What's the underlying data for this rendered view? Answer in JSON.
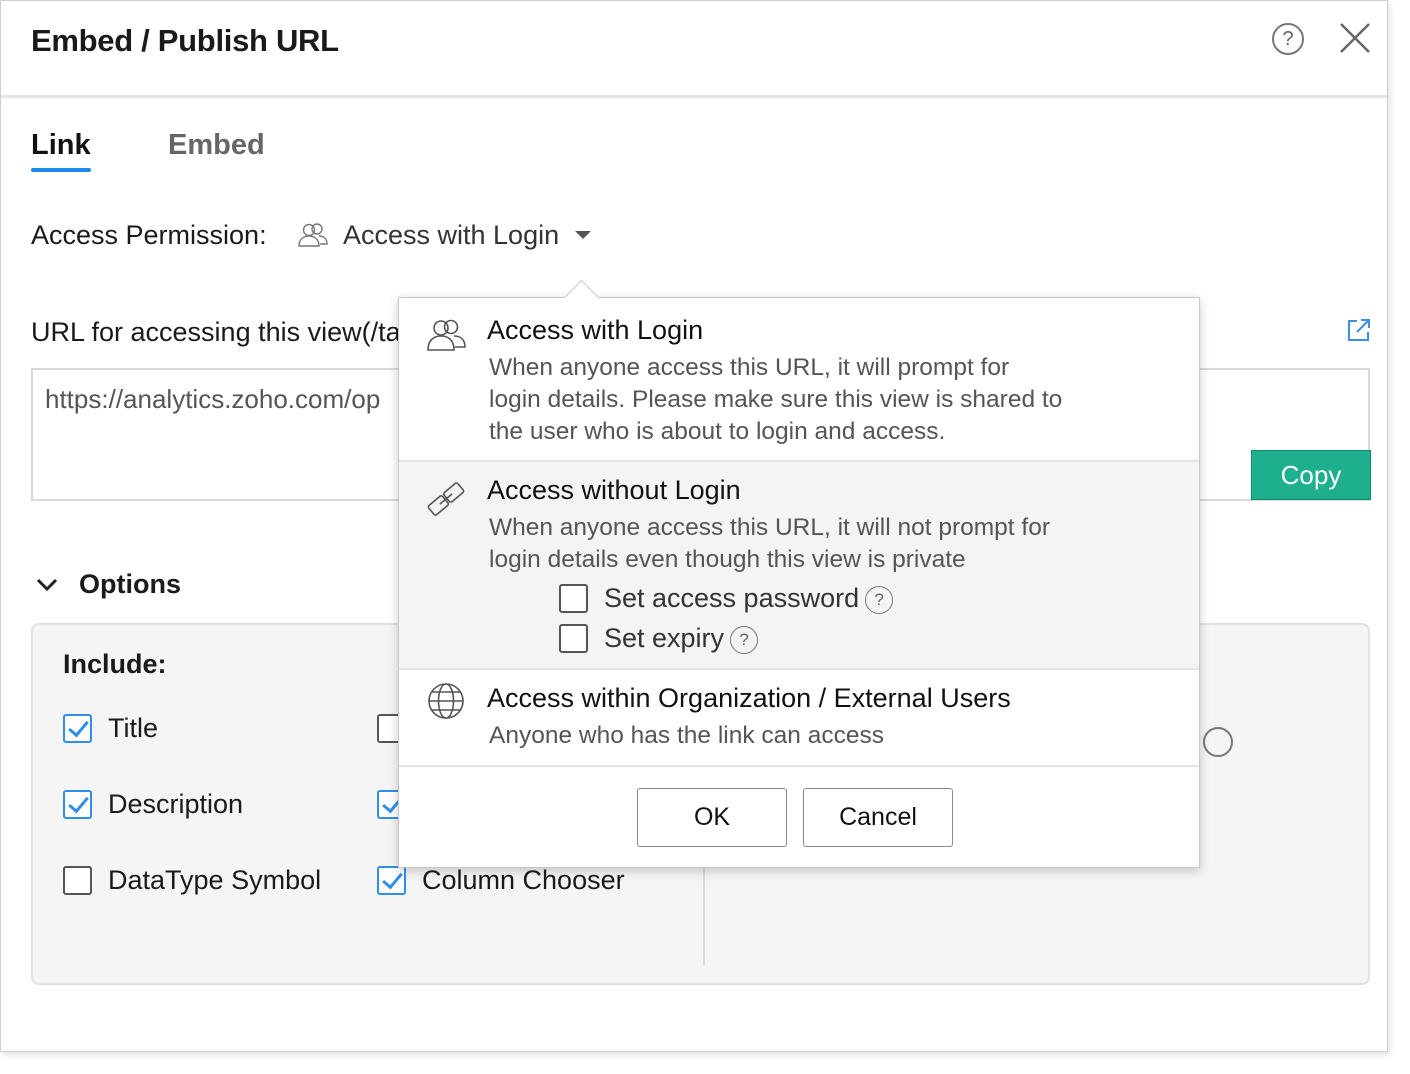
{
  "dialog": {
    "title": "Embed / Publish URL",
    "help_glyph": "?",
    "close_icon": "close-icon"
  },
  "tabs": [
    {
      "label": "Link",
      "active": true
    },
    {
      "label": "Embed",
      "active": false
    }
  ],
  "access": {
    "label": "Access Permission:",
    "selected": "Access with Login",
    "icon": "users-icon"
  },
  "url": {
    "label": "URL for accessing this view(/ta",
    "value": "https://analytics.zoho.com/op",
    "copy_label": "Copy",
    "open_icon": "external-link-icon"
  },
  "options": {
    "label": "Options",
    "include_label": "Include:",
    "items": [
      {
        "label": "Title",
        "checked": true
      },
      {
        "label": "Description",
        "checked": true
      },
      {
        "label": "DataType Symbol",
        "checked": false
      },
      {
        "label": "Column Chooser",
        "checked": true
      }
    ]
  },
  "popover": {
    "items": [
      {
        "title": "Access with Login",
        "icon": "users-icon",
        "desc": [
          "When anyone access this URL, it will prompt for",
          "login details. Please make sure this view is shared to",
          "the user who is about to login and access."
        ]
      },
      {
        "title": "Access without Login",
        "icon": "link-icon",
        "desc": [
          "When anyone access this URL, it will not prompt for",
          "login details even though this view is private"
        ],
        "suboptions": [
          {
            "label": "Set access password",
            "checked": false,
            "help": "?"
          },
          {
            "label": "Set expiry",
            "checked": false,
            "help": "?"
          }
        ]
      },
      {
        "title": "Access within Organization / External Users",
        "icon": "globe-icon",
        "desc": [
          "Anyone who has the link can access"
        ]
      }
    ],
    "ok_label": "OK",
    "cancel_label": "Cancel"
  },
  "colors": {
    "accent": "#1a8bea",
    "copy_button": "#1eb08e",
    "checkbox": "#2f8fe8"
  }
}
